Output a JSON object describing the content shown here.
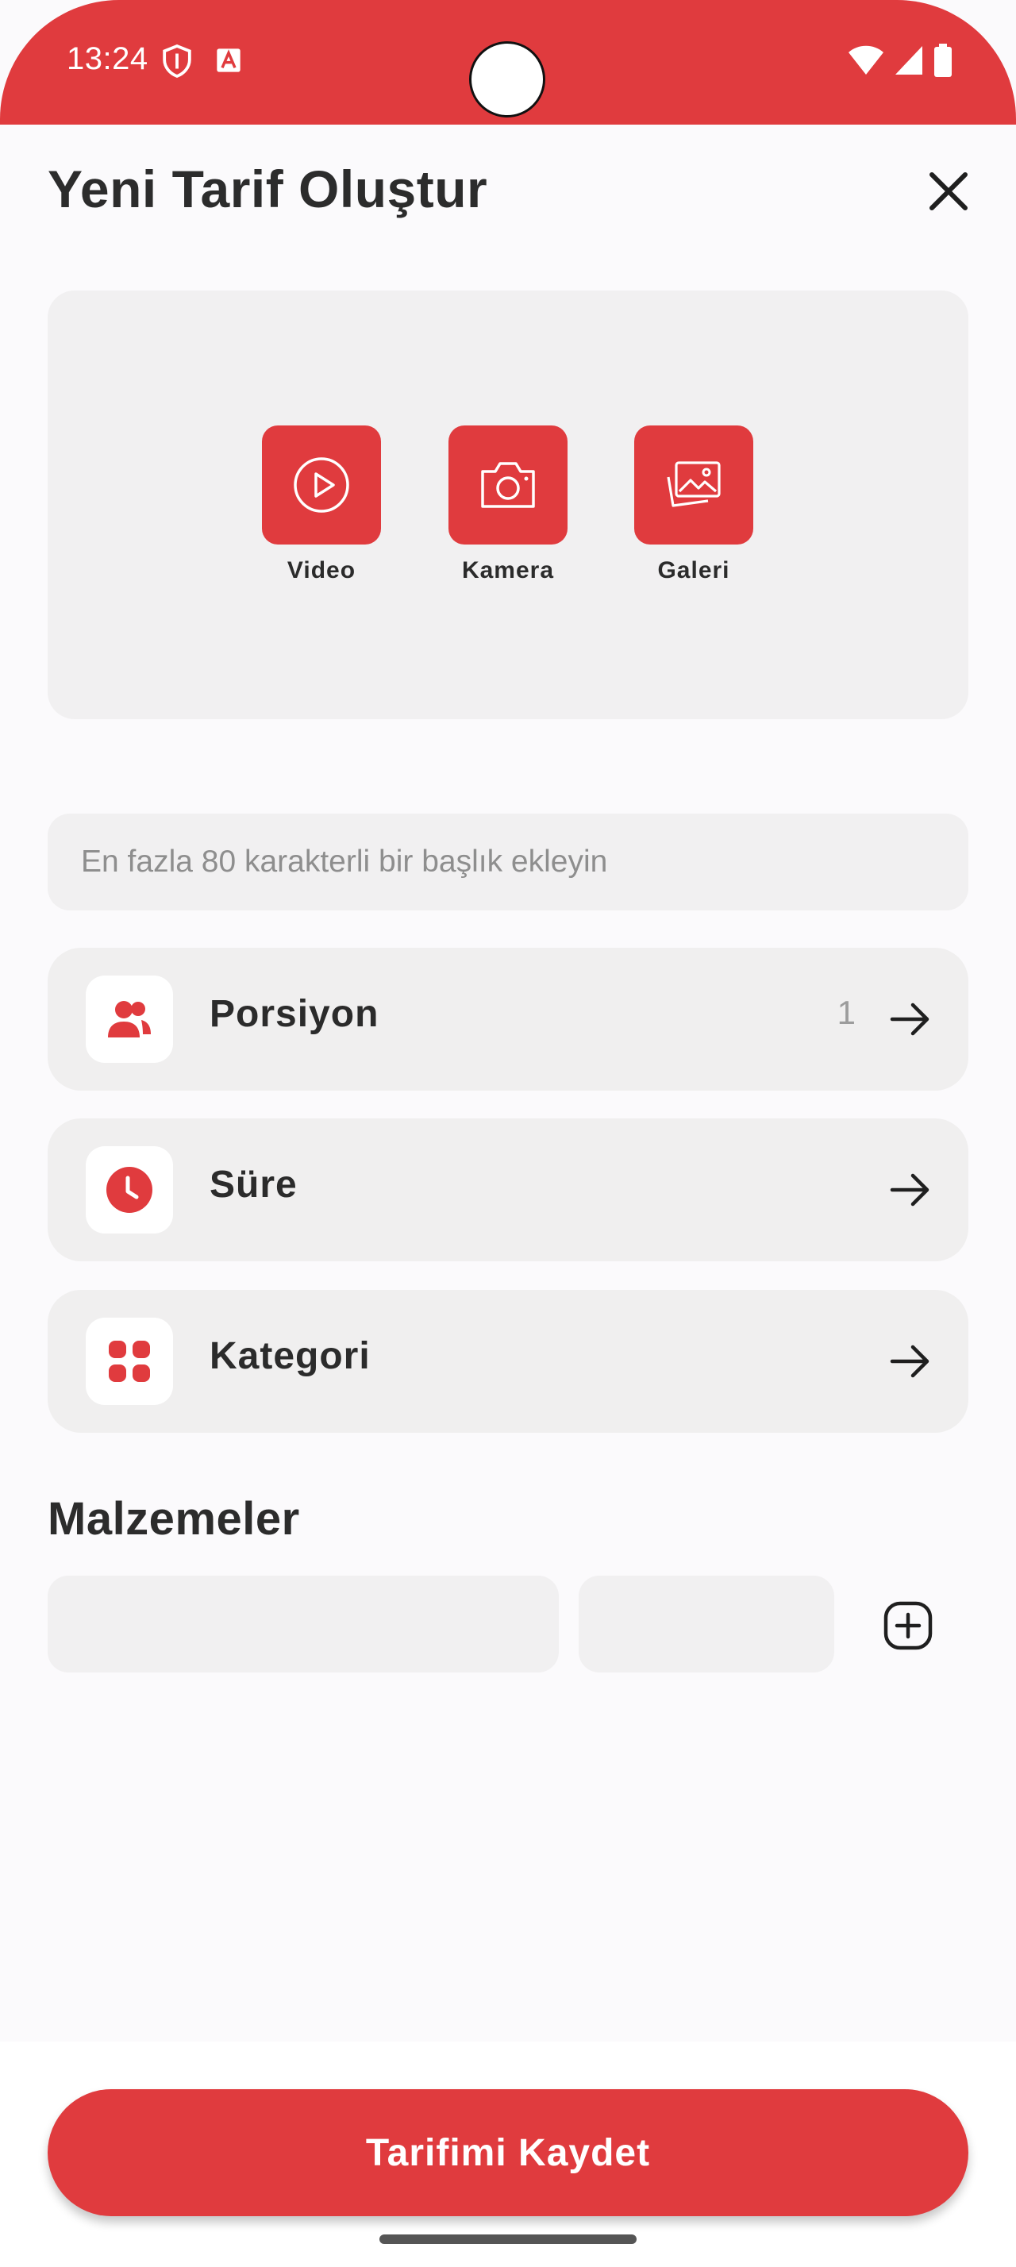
{
  "status_bar": {
    "time": "13:24",
    "color": "#e03b3e"
  },
  "header": {
    "title": "Yeni Tarif Oluştur"
  },
  "media": {
    "buttons": [
      {
        "label": "Video",
        "icon": "play-circle-icon"
      },
      {
        "label": "Kamera",
        "icon": "camera-icon"
      },
      {
        "label": "Galeri",
        "icon": "gallery-icon"
      }
    ]
  },
  "title_field": {
    "placeholder": "En fazla 80 karakterli bir başlık ekleyin",
    "value": ""
  },
  "options": [
    {
      "label": "Porsiyon",
      "value": "1",
      "icon": "people-icon"
    },
    {
      "label": "Süre",
      "value": "",
      "icon": "clock-icon"
    },
    {
      "label": "Kategori",
      "value": "",
      "icon": "grid-icon"
    }
  ],
  "ingredients": {
    "title": "Malzemeler",
    "name_value": "",
    "quantity_value": ""
  },
  "footer": {
    "save_label": "Tarifimi Kaydet"
  },
  "colors": {
    "accent": "#e03b3e",
    "field_bg": "#f1f0f1",
    "page_bg": "#fbfafc"
  }
}
